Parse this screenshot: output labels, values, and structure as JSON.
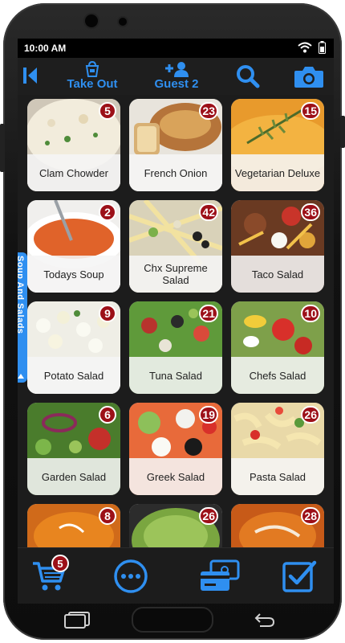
{
  "status": {
    "time": "10:00 AM"
  },
  "appbar": {
    "back_icon": "back-arrow-icon",
    "take_out_label": "Take Out",
    "guest_label": "Guest 2",
    "search_icon": "search-icon",
    "camera_icon": "camera-icon"
  },
  "category_tab": {
    "label": "Soup And Salads"
  },
  "items": [
    {
      "name": "Clam Chowder",
      "count": "5"
    },
    {
      "name": "French Onion",
      "count": "23"
    },
    {
      "name": "Vegetarian Deluxe",
      "count": "15"
    },
    {
      "name": "Todays Soup",
      "count": "2"
    },
    {
      "name": "Chx Supreme Salad",
      "count": "42"
    },
    {
      "name": "Taco Salad",
      "count": "36"
    },
    {
      "name": "Potato Salad",
      "count": "9"
    },
    {
      "name": "Tuna Salad",
      "count": "21"
    },
    {
      "name": "Chefs Salad",
      "count": "10"
    },
    {
      "name": "Garden Salad",
      "count": "6"
    },
    {
      "name": "Greek Salad",
      "count": "19"
    },
    {
      "name": "Pasta Salad",
      "count": "26"
    },
    {
      "name": "",
      "count": "8"
    },
    {
      "name": "",
      "count": "26"
    },
    {
      "name": "",
      "count": "28"
    }
  ],
  "bottombar": {
    "cart_count": "5"
  },
  "colors": {
    "accent": "#2f8ff0",
    "badge": "#9c1018",
    "background": "#1c1c1c"
  }
}
